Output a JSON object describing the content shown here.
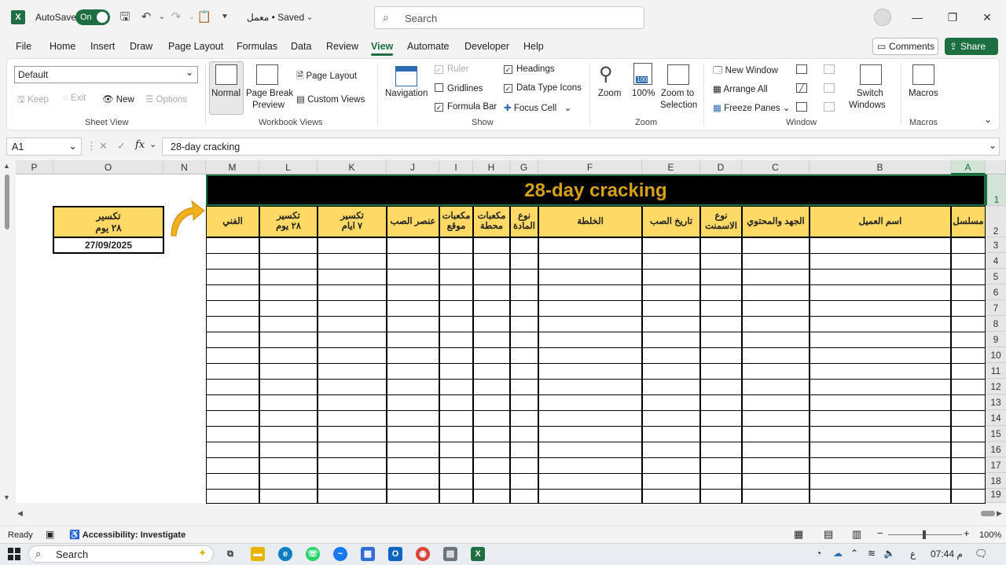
{
  "titlebar": {
    "autosave_label": "AutoSave",
    "autosave_state": "On",
    "doc_title": "معمل • Saved",
    "search_placeholder": "Search"
  },
  "ribbon_tabs": [
    "File",
    "Home",
    "Insert",
    "Draw",
    "Page Layout",
    "Formulas",
    "Data",
    "Review",
    "View",
    "Automate",
    "Developer",
    "Help"
  ],
  "active_tab": "View",
  "comments_label": "Comments",
  "share_label": "Share",
  "sheet_view": {
    "dropdown_value": "Default",
    "keep": "Keep",
    "exit": "Exit",
    "new": "New",
    "options": "Options",
    "group_label": "Sheet View"
  },
  "workbook_views": {
    "normal": "Normal",
    "page_break_1": "Page Break",
    "page_break_2": "Preview",
    "page_layout": "Page Layout",
    "custom_views": "Custom Views",
    "group_label": "Workbook Views"
  },
  "show": {
    "navigation": "Navigation",
    "ruler": "Ruler",
    "gridlines": "Gridlines",
    "formula_bar": "Formula Bar",
    "headings": "Headings",
    "data_type_icons": "Data Type Icons",
    "focus_cell": "Focus Cell",
    "group_label": "Show"
  },
  "zoom": {
    "zoom": "Zoom",
    "hundred": "100%",
    "zoom_sel_1": "Zoom to",
    "zoom_sel_2": "Selection",
    "group_label": "Zoom"
  },
  "window": {
    "new_window": "New Window",
    "arrange_all": "Arrange All",
    "freeze_panes": "Freeze Panes",
    "switch_1": "Switch",
    "switch_2": "Windows",
    "group_label": "Window"
  },
  "macros": {
    "label": "Macros",
    "group_label": "Macros"
  },
  "formula_bar": {
    "name_box": "A1",
    "formula": "28-day cracking"
  },
  "columns": [
    "P",
    "O",
    "N",
    "M",
    "L",
    "K",
    "J",
    "I",
    "H",
    "G",
    "F",
    "E",
    "D",
    "C",
    "B",
    "A"
  ],
  "rows": [
    "1",
    "2",
    "3",
    "4",
    "5",
    "6",
    "7",
    "8",
    "9",
    "10",
    "11",
    "12",
    "13",
    "14",
    "15",
    "16",
    "17",
    "18",
    "19"
  ],
  "sheet": {
    "title": "28-day cracking",
    "headers": {
      "M": "الفني",
      "L1": "تكسير",
      "L2": "٢٨ يوم",
      "K1": "تكسير",
      "K2": "٧ ايام",
      "J": "عنصر الصب",
      "I1": "مكعبات",
      "I2": "موقع",
      "H1": "مكعبات",
      "H2": "محطة",
      "G1": "نوع",
      "G2": "المادة",
      "F": "الخلطة",
      "E": "تاريخ الصب",
      "D1": "نوع",
      "D2": "الاسمنت",
      "C": "الجهد والمحتوي",
      "B": "اسم العميل",
      "A": "مسلسل"
    },
    "side_label_1": "تكسير",
    "side_label_2": "٢٨ يوم",
    "side_date": "27/09/2025"
  },
  "status": {
    "ready": "Ready",
    "accessibility": "Accessibility: Investigate",
    "zoom_level": "100%"
  },
  "taskbar": {
    "search": "Search",
    "time": "07:44 م",
    "lang": "ع"
  },
  "colors": {
    "excel_green": "#1d6f42",
    "header_fill": "#ffd966",
    "title_text": "#d4a017",
    "arrow": "#f2b01e"
  }
}
